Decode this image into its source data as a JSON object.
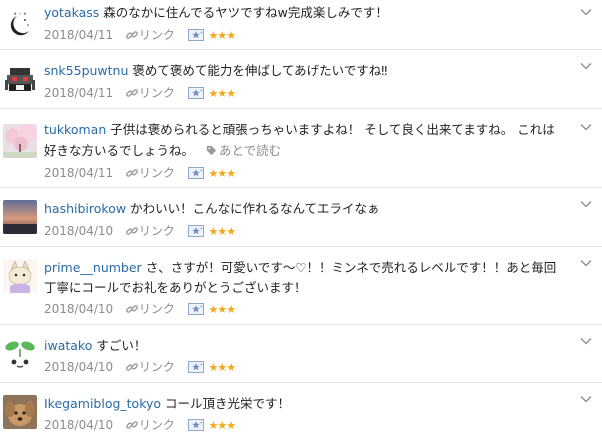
{
  "colors": {
    "username": "#2a6aa5",
    "star": "#f3a81a",
    "meta": "#8d8d8d",
    "divider": "#e6e6e6"
  },
  "icons": {
    "link": "link-icon",
    "star_badge": "star-badge-icon",
    "menu": "chevron-down-icon",
    "tag": "tag-icon"
  },
  "stars_text": "★★★",
  "comments": [
    {
      "username": "yotakass",
      "text": "森のなかに住んでるヤツですねw完成楽しみです！",
      "date": "2018/04/11",
      "link_label": "リンク"
    },
    {
      "username": "snk55puwtnu",
      "text": "褒めて褒めて能力を伸ばしてあげたいですね‼",
      "date": "2018/04/11",
      "link_label": "リンク"
    },
    {
      "username": "tukkoman",
      "text_line1": "子供は褒められると頑張っちゃいますよね！ そして良く出来てますね。 これは",
      "text_line2": "好きな方いるでしょうね。",
      "read_later": "あとで読む",
      "date": "2018/04/11",
      "link_label": "リンク"
    },
    {
      "username": "hashibirokow",
      "text": "かわいい！こんなに作れるなんてエライなぁ",
      "date": "2018/04/10",
      "link_label": "リンク"
    },
    {
      "username": "prime__number",
      "text_line1": "さ、さすが！可愛いです〜♡！！ミンネで売れるレベルです！！あと毎回",
      "text_line2": "丁寧にコールでお礼をありがとうございます！",
      "date": "2018/04/10",
      "link_label": "リンク"
    },
    {
      "username": "iwatako",
      "text": "すごい！",
      "date": "2018/04/10",
      "link_label": "リンク"
    },
    {
      "username": "Ikegamiblog_tokyo",
      "text": "コール頂き光栄です！",
      "date": "2018/04/10",
      "link_label": "リンク"
    }
  ]
}
